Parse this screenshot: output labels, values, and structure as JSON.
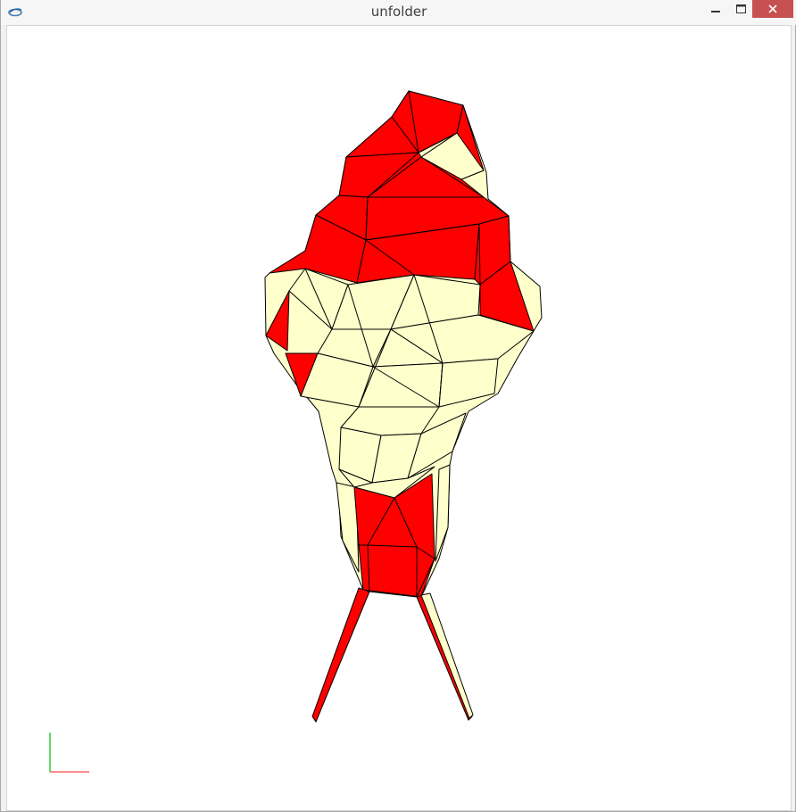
{
  "window": {
    "title": "unfolder",
    "icon": "app-logo-icon",
    "controls": [
      "minimize-icon",
      "maximize-icon",
      "close-icon"
    ]
  },
  "viewport": {
    "background": "#ffffff",
    "model": {
      "face_colors": {
        "front": "#ff0000",
        "back": "#ffffcc"
      },
      "edge_color": "#000000"
    },
    "axes_indicator": {
      "x_color": "#ff6666",
      "y_color": "#33cc33"
    }
  }
}
